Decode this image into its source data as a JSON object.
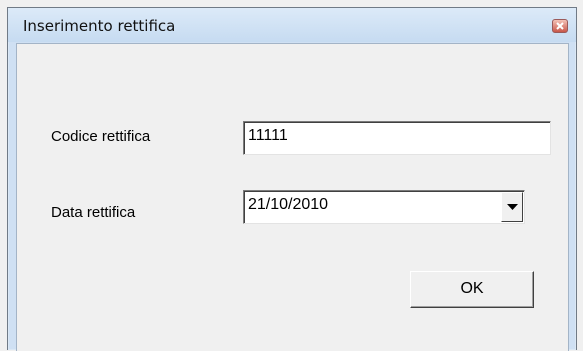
{
  "window": {
    "title": "Inserimento rettifica",
    "close_icon": "close-icon"
  },
  "form": {
    "codice": {
      "label": "Codice rettifica",
      "value": "11111"
    },
    "data": {
      "label": "Data rettifica",
      "value": "21/10/2010",
      "arrow_icon": "chevron-down-icon"
    },
    "ok_label": "OK"
  }
}
